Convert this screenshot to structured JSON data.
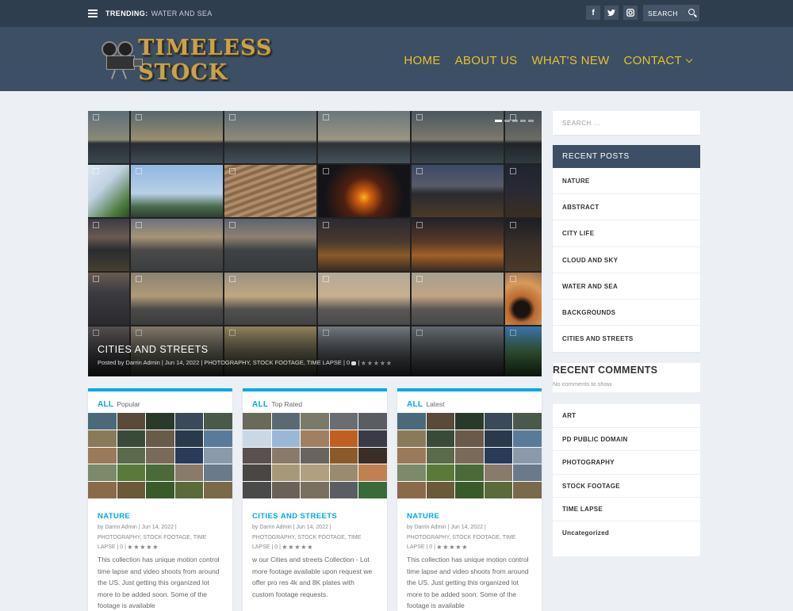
{
  "topbar": {
    "trending_label": "TRENDING:",
    "trending_value": "WATER AND SEA",
    "search_label": "SEARCH",
    "social_icons": [
      "facebook-icon",
      "twitter-icon",
      "instagram-icon"
    ]
  },
  "header": {
    "logo_text": "TIMELESS STOCK",
    "nav": [
      {
        "label": "HOME"
      },
      {
        "label": "ABOUT US"
      },
      {
        "label": "WHAT'S NEW"
      },
      {
        "label": "CONTACT"
      }
    ]
  },
  "feature": {
    "title": "CITIES AND STREETS",
    "meta": "Posted by Darrin Admin | Jun 14, 2022 | PHOTOGRAPHY, STOCK FOOTAGE, TIME LAPSE | 0"
  },
  "cards": [
    {
      "tab_all": "ALL",
      "tab_sub": "Popular",
      "title": "NATURE",
      "meta_line1": "by Darrin Admin | Jun 14, 2022 |",
      "meta_line2": "PHOTOGRAPHY, STOCK FOOTAGE, TIME",
      "meta_line3": "LAPSE | 0",
      "excerpt": "This collection has unique motion control time lapse and video shoots from around the US. Just getting this organized lot more to be added soon. Some of the footage is available"
    },
    {
      "tab_all": "ALL",
      "tab_sub": "Top Rated",
      "title": "CITIES AND STREETS",
      "meta_line1": "by Darrin Admin | Jun 14, 2022 |",
      "meta_line2": "PHOTOGRAPHY, STOCK FOOTAGE, TIME",
      "meta_line3": "LAPSE | 0",
      "excerpt": "w our Cities and streets Collection - Lot more footage available upon request we offer pro res 4k and 8K plates with custom footage requests."
    },
    {
      "tab_all": "ALL",
      "tab_sub": "Latest",
      "title": "NATURE",
      "meta_line1": "by Darrin Admin | Jun 14, 2022 |",
      "meta_line2": "PHOTOGRAPHY, STOCK FOOTAGE, TIME",
      "meta_line3": "LAPSE | 0",
      "excerpt": "This collection has unique motion control time lapse and video shoots from around the US. Just getting this organized lot more to be added soon. Some of the footage is available"
    }
  ],
  "sidebar": {
    "search_placeholder": "SEARCH ...",
    "recent_posts_title": "RECENT POSTS",
    "recent_posts": [
      "NATURE",
      "ABSTRACT",
      "CITY LIFE",
      "CLOUD AND SKY",
      "WATER AND SEA",
      "BACKGROUNDS",
      "CITIES AND STREETS"
    ],
    "recent_comments_title": "RECENT COMMENTS",
    "recent_comments_text": "No comments to show.",
    "categories": [
      "ART",
      "PD PUBLIC DOMAIN",
      "PHOTOGRAPHY",
      "STOCK FOOTAGE",
      "TIME LAPSE",
      "Uncategorized"
    ]
  },
  "colors": {
    "topbar": "#2f3e4e",
    "header": "#3d4f64",
    "nav_text": "#e8c227",
    "accent": "#00a8e6",
    "page_bg": "#ecf0f4"
  }
}
